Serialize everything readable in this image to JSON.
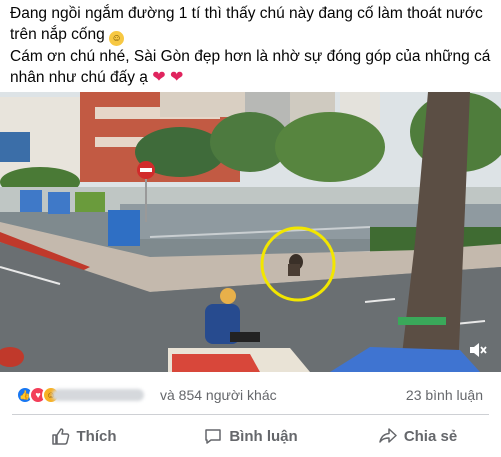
{
  "post": {
    "text_line1": "Đang ngồi ngắm đường 1 tí thì thấy chú này đang cố làm thoát nước trên nắp cống",
    "text_line2": "Cám ơn chú nhé, Sài Gòn đẹp hơn là nhờ sự đóng góp của những cá nhân như chú đấy ạ"
  },
  "reactions": {
    "others": "và 854 người khác",
    "comments": "23 bình luận",
    "icons": [
      "like-icon",
      "love-icon",
      "haha-icon"
    ]
  },
  "actions": {
    "like": "Thích",
    "comment": "Bình luận",
    "share": "Chia sẻ"
  },
  "colors": {
    "heart": "#e0245e",
    "like_blue": "#1877f2",
    "highlight_circle": "#f2e600",
    "muted_text": "#65676b"
  }
}
